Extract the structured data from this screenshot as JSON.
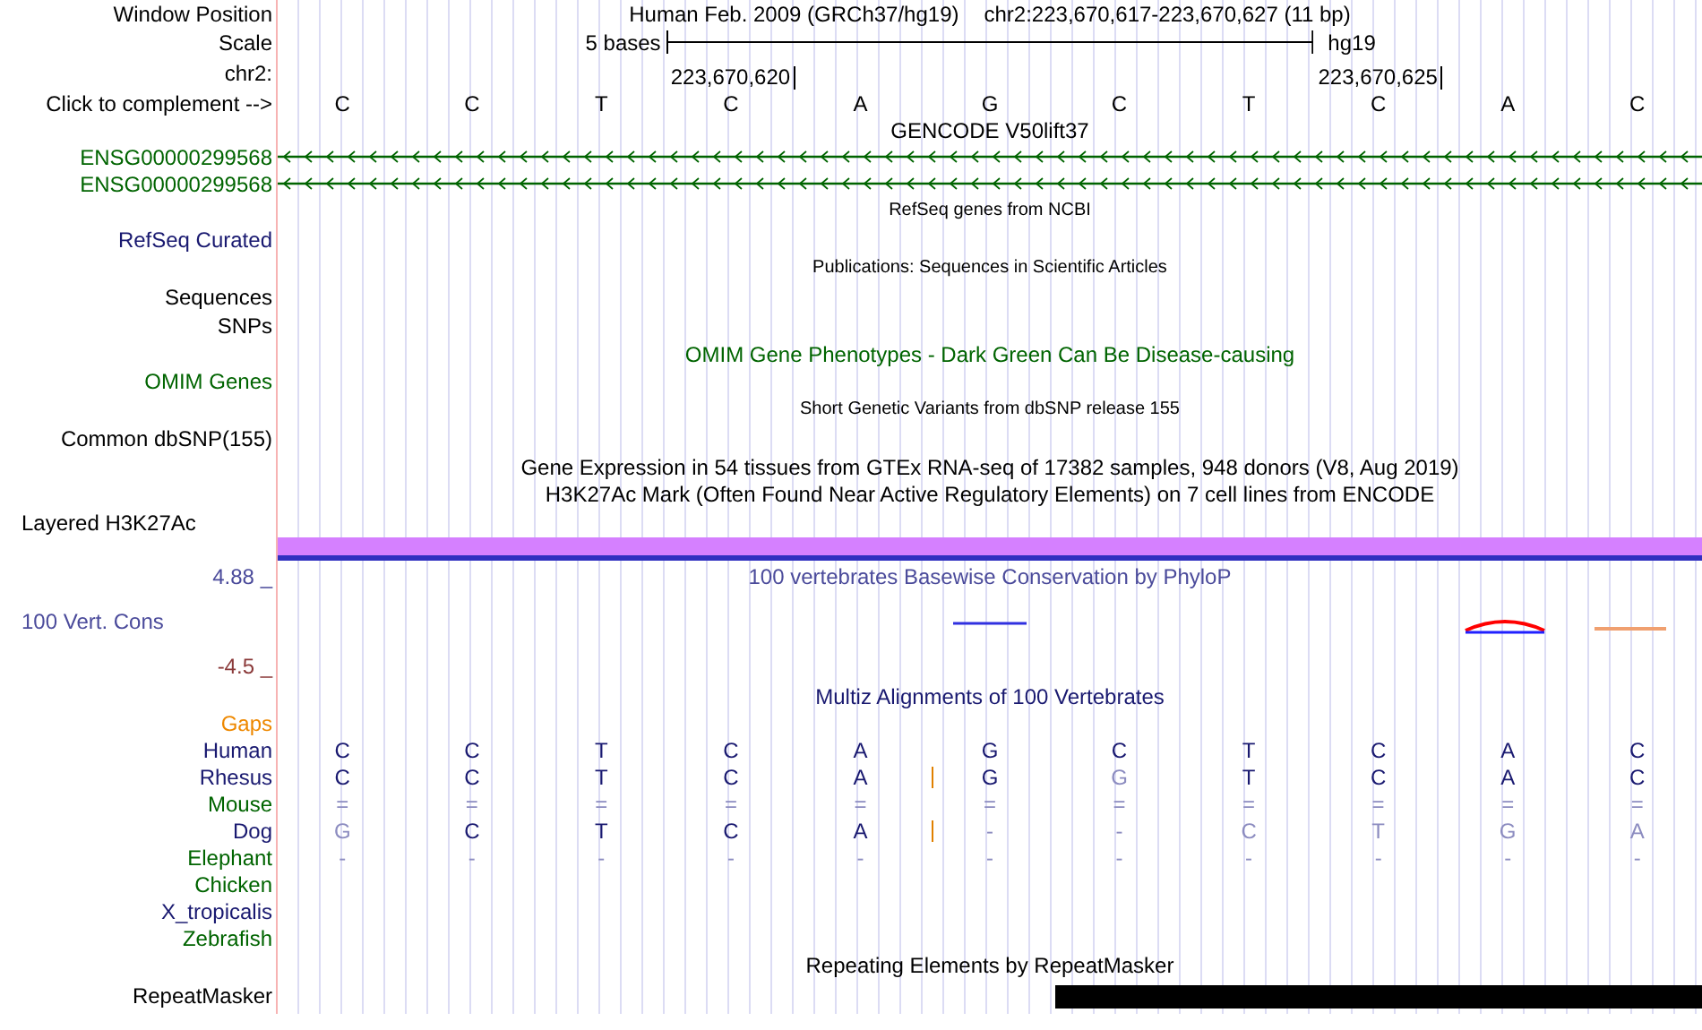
{
  "position": {
    "label": "Window Position",
    "assembly": "Human Feb. 2009 (GRCh37/hg19)",
    "range": "chr2:223,670,617-223,670,627 (11 bp)"
  },
  "scale": {
    "label": "Scale",
    "length": "5 bases",
    "assembly": "hg19"
  },
  "coordinates": {
    "label": "chr2:",
    "ticks": [
      "223,670,620",
      "223,670,625"
    ]
  },
  "sequence": {
    "label": "Click to complement -->",
    "bases": [
      "C",
      "C",
      "T",
      "C",
      "A",
      "G",
      "C",
      "T",
      "C",
      "A",
      "C"
    ]
  },
  "tracks": [
    {
      "kind": "title",
      "text": "GENCODE V50lift37",
      "color": "#000000"
    },
    {
      "kind": "gene",
      "label": "ENSG00000299568",
      "color": "#006400"
    },
    {
      "kind": "gene",
      "label": "ENSG00000299568",
      "color": "#006400"
    },
    {
      "kind": "note",
      "text": "RefSeq genes from NCBI",
      "color": "#000000"
    },
    {
      "kind": "label",
      "label": "RefSeq Curated",
      "color": "#191970"
    },
    {
      "kind": "note",
      "text": "Publications: Sequences in Scientific Articles",
      "color": "#000000"
    },
    {
      "kind": "label",
      "label": "Sequences",
      "color": "#000000"
    },
    {
      "kind": "label",
      "label": "SNPs",
      "color": "#000000"
    },
    {
      "kind": "title",
      "text": "OMIM Gene Phenotypes - Dark Green Can Be Disease-causing",
      "color": "#006400"
    },
    {
      "kind": "label",
      "label": "OMIM Genes",
      "color": "#006400"
    },
    {
      "kind": "note",
      "text": "Short Genetic Variants from dbSNP release 155",
      "color": "#000000"
    },
    {
      "kind": "label",
      "label": "Common dbSNP(155)",
      "color": "#000000"
    },
    {
      "kind": "title",
      "text": "Gene Expression in 54 tissues from GTEx RNA-seq of 17382 samples, 948 donors (V8, Aug 2019)",
      "color": "#000000"
    },
    {
      "kind": "title",
      "text": "H3K27Ac Mark (Often Found Near Active Regulatory Elements) on 7 cell lines from ENCODE",
      "color": "#000000"
    },
    {
      "kind": "bar",
      "label": "Layered H3K27Ac",
      "color": "#000000"
    },
    {
      "kind": "wiggle",
      "max": "4.88 _",
      "label": "100 Vert. Cons",
      "min": "-4.5 _",
      "title": "100 vertebrates Basewise Conservation by PhyloP",
      "color": "#4b4b9b"
    },
    {
      "kind": "title",
      "text": "Multiz Alignments of 100 Vertebrates",
      "color": "#191970"
    },
    {
      "kind": "species",
      "label": "Gaps",
      "color": "#ee8800"
    },
    {
      "kind": "species",
      "label": "Human",
      "color": "#191970",
      "cells": [
        {
          "text": "C",
          "faint": false,
          "insertion": false
        },
        {
          "text": "C",
          "faint": false,
          "insertion": false
        },
        {
          "text": "T",
          "faint": false,
          "insertion": false
        },
        {
          "text": "C",
          "faint": false,
          "insertion": false
        },
        {
          "text": "A",
          "faint": false,
          "insertion": false
        },
        {
          "text": "G",
          "faint": false,
          "insertion": false
        },
        {
          "text": "C",
          "faint": false,
          "insertion": false
        },
        {
          "text": "T",
          "faint": false,
          "insertion": false
        },
        {
          "text": "C",
          "faint": false,
          "insertion": false
        },
        {
          "text": "A",
          "faint": false,
          "insertion": false
        },
        {
          "text": "C",
          "faint": false,
          "insertion": false
        }
      ]
    },
    {
      "kind": "species",
      "label": "Rhesus",
      "color": "#191970",
      "cells": [
        {
          "text": "C",
          "faint": false,
          "insertion": false
        },
        {
          "text": "C",
          "faint": false,
          "insertion": false
        },
        {
          "text": "T",
          "faint": false,
          "insertion": false
        },
        {
          "text": "C",
          "faint": false,
          "insertion": false
        },
        {
          "text": "A",
          "faint": false,
          "insertion": true
        },
        {
          "text": "G",
          "faint": false,
          "insertion": false
        },
        {
          "text": "G",
          "faint": true,
          "insertion": false
        },
        {
          "text": "T",
          "faint": false,
          "insertion": false
        },
        {
          "text": "C",
          "faint": false,
          "insertion": false
        },
        {
          "text": "A",
          "faint": false,
          "insertion": false
        },
        {
          "text": "C",
          "faint": false,
          "insertion": false
        }
      ]
    },
    {
      "kind": "species",
      "label": "Mouse",
      "color": "#006400",
      "cells": [
        {
          "text": "=",
          "faint": true,
          "insertion": false
        },
        {
          "text": "=",
          "faint": true,
          "insertion": false
        },
        {
          "text": "=",
          "faint": true,
          "insertion": false
        },
        {
          "text": "=",
          "faint": true,
          "insertion": false
        },
        {
          "text": "=",
          "faint": true,
          "insertion": false
        },
        {
          "text": "=",
          "faint": true,
          "insertion": false
        },
        {
          "text": "=",
          "faint": true,
          "insertion": false
        },
        {
          "text": "=",
          "faint": true,
          "insertion": false
        },
        {
          "text": "=",
          "faint": true,
          "insertion": false
        },
        {
          "text": "=",
          "faint": true,
          "insertion": false
        },
        {
          "text": "=",
          "faint": true,
          "insertion": false
        }
      ]
    },
    {
      "kind": "species",
      "label": "Dog",
      "color": "#191970",
      "cells": [
        {
          "text": "G",
          "faint": true,
          "insertion": false
        },
        {
          "text": "C",
          "faint": false,
          "insertion": false
        },
        {
          "text": "T",
          "faint": false,
          "insertion": false
        },
        {
          "text": "C",
          "faint": false,
          "insertion": false
        },
        {
          "text": "A",
          "faint": false,
          "insertion": true
        },
        {
          "text": "-",
          "faint": true,
          "insertion": false
        },
        {
          "text": "-",
          "faint": true,
          "insertion": false
        },
        {
          "text": "C",
          "faint": true,
          "insertion": false
        },
        {
          "text": "T",
          "faint": true,
          "insertion": false
        },
        {
          "text": "G",
          "faint": true,
          "insertion": false
        },
        {
          "text": "A",
          "faint": true,
          "insertion": false
        }
      ]
    },
    {
      "kind": "species",
      "label": "Elephant",
      "color": "#006400",
      "cells": [
        {
          "text": "-",
          "faint": true,
          "insertion": false
        },
        {
          "text": "-",
          "faint": true,
          "insertion": false
        },
        {
          "text": "-",
          "faint": true,
          "insertion": false
        },
        {
          "text": "-",
          "faint": true,
          "insertion": false
        },
        {
          "text": "-",
          "faint": true,
          "insertion": false
        },
        {
          "text": "-",
          "faint": true,
          "insertion": false
        },
        {
          "text": "-",
          "faint": true,
          "insertion": false
        },
        {
          "text": "-",
          "faint": true,
          "insertion": false
        },
        {
          "text": "-",
          "faint": true,
          "insertion": false
        },
        {
          "text": "-",
          "faint": true,
          "insertion": false
        },
        {
          "text": "-",
          "faint": true,
          "insertion": false
        }
      ]
    },
    {
      "kind": "species",
      "label": "Chicken",
      "color": "#006400"
    },
    {
      "kind": "species",
      "label": "X_tropicalis",
      "color": "#191970"
    },
    {
      "kind": "species",
      "label": "Zebrafish",
      "color": "#006400"
    },
    {
      "kind": "title",
      "text": "Repeating Elements by RepeatMasker",
      "color": "#000000"
    },
    {
      "kind": "repeat",
      "label": "RepeatMasker",
      "color": "#000000"
    }
  ]
}
